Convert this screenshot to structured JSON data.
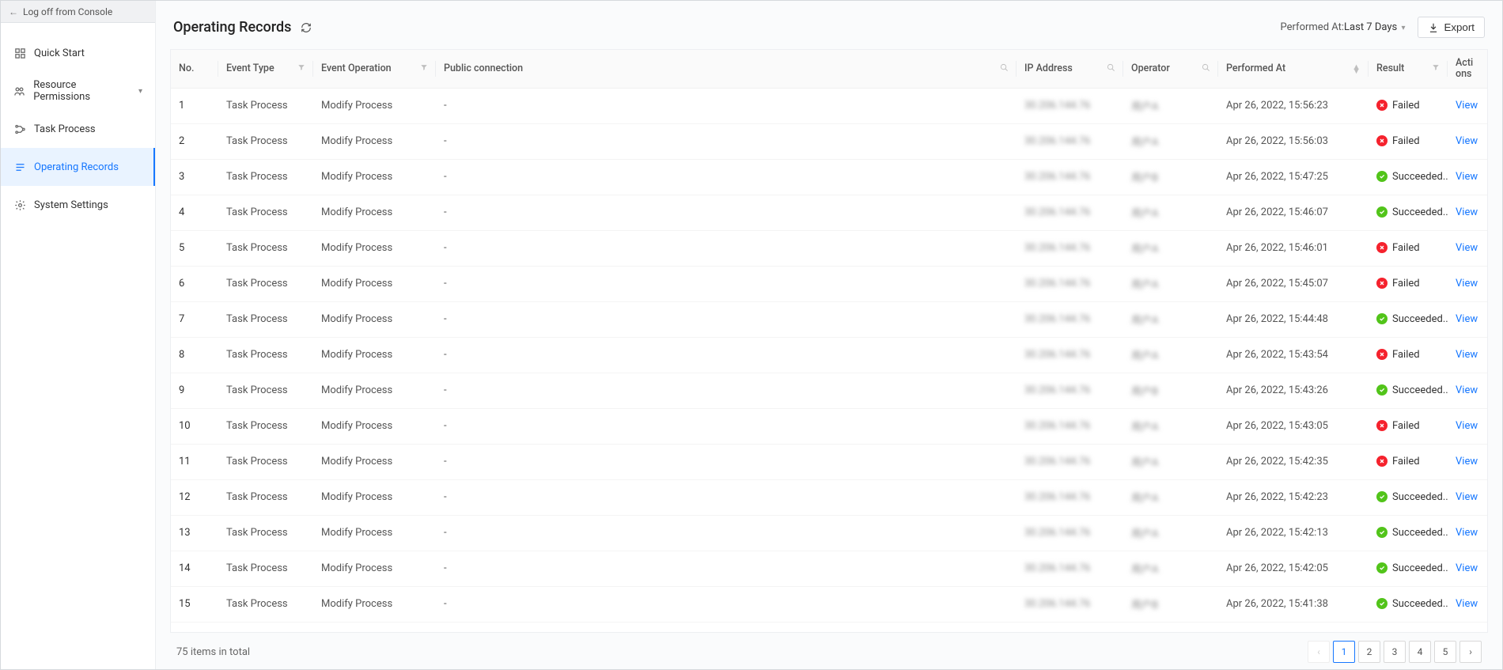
{
  "sidebar": {
    "logoff": "Log off from Console",
    "items": [
      {
        "label": "Quick Start",
        "active": false,
        "expandable": false
      },
      {
        "label": "Resource Permissions",
        "active": false,
        "expandable": true
      },
      {
        "label": "Task Process",
        "active": false,
        "expandable": false
      },
      {
        "label": "Operating Records",
        "active": true,
        "expandable": false
      },
      {
        "label": "System Settings",
        "active": false,
        "expandable": false
      }
    ]
  },
  "header": {
    "title": "Operating Records",
    "range_label": "Performed At:",
    "range_value": "Last 7 Days",
    "export": "Export"
  },
  "columns": {
    "no": "No.",
    "event_type": "Event Type",
    "event_operation": "Event Operation",
    "public_connection": "Public connection",
    "ip_address": "IP Address",
    "operator": "Operator",
    "performed_at": "Performed At",
    "result": "Result",
    "actions_l1": "Acti",
    "actions_l2": "ons"
  },
  "rows": [
    {
      "no": "1",
      "event_type": "Task Process",
      "event_operation": "Modify Process",
      "public_connection": "-",
      "ip": "30.206.144.76",
      "operator": "用户A",
      "performed_at": "Apr 26, 2022, 15:56:23",
      "result": "Failed",
      "action": "View"
    },
    {
      "no": "2",
      "event_type": "Task Process",
      "event_operation": "Modify Process",
      "public_connection": "-",
      "ip": "30.206.144.76",
      "operator": "用户A",
      "performed_at": "Apr 26, 2022, 15:56:03",
      "result": "Failed",
      "action": "View"
    },
    {
      "no": "3",
      "event_type": "Task Process",
      "event_operation": "Modify Process",
      "public_connection": "-",
      "ip": "30.206.144.76",
      "operator": "用户B",
      "performed_at": "Apr 26, 2022, 15:47:25",
      "result": "Succeeded...",
      "action": "View"
    },
    {
      "no": "4",
      "event_type": "Task Process",
      "event_operation": "Modify Process",
      "public_connection": "-",
      "ip": "30.206.144.76",
      "operator": "用户A",
      "performed_at": "Apr 26, 2022, 15:46:07",
      "result": "Succeeded...",
      "action": "View"
    },
    {
      "no": "5",
      "event_type": "Task Process",
      "event_operation": "Modify Process",
      "public_connection": "-",
      "ip": "30.206.144.76",
      "operator": "用户A",
      "performed_at": "Apr 26, 2022, 15:46:01",
      "result": "Failed",
      "action": "View"
    },
    {
      "no": "6",
      "event_type": "Task Process",
      "event_operation": "Modify Process",
      "public_connection": "-",
      "ip": "30.206.144.76",
      "operator": "用户A",
      "performed_at": "Apr 26, 2022, 15:45:07",
      "result": "Failed",
      "action": "View"
    },
    {
      "no": "7",
      "event_type": "Task Process",
      "event_operation": "Modify Process",
      "public_connection": "-",
      "ip": "30.206.144.76",
      "operator": "用户A",
      "performed_at": "Apr 26, 2022, 15:44:48",
      "result": "Succeeded...",
      "action": "View"
    },
    {
      "no": "8",
      "event_type": "Task Process",
      "event_operation": "Modify Process",
      "public_connection": "-",
      "ip": "30.206.144.76",
      "operator": "用户A",
      "performed_at": "Apr 26, 2022, 15:43:54",
      "result": "Failed",
      "action": "View"
    },
    {
      "no": "9",
      "event_type": "Task Process",
      "event_operation": "Modify Process",
      "public_connection": "-",
      "ip": "30.206.144.76",
      "operator": "用户B",
      "performed_at": "Apr 26, 2022, 15:43:26",
      "result": "Succeeded...",
      "action": "View"
    },
    {
      "no": "10",
      "event_type": "Task Process",
      "event_operation": "Modify Process",
      "public_connection": "-",
      "ip": "30.206.144.76",
      "operator": "用户A",
      "performed_at": "Apr 26, 2022, 15:43:05",
      "result": "Failed",
      "action": "View"
    },
    {
      "no": "11",
      "event_type": "Task Process",
      "event_operation": "Modify Process",
      "public_connection": "-",
      "ip": "30.206.144.76",
      "operator": "用户A",
      "performed_at": "Apr 26, 2022, 15:42:35",
      "result": "Failed",
      "action": "View"
    },
    {
      "no": "12",
      "event_type": "Task Process",
      "event_operation": "Modify Process",
      "public_connection": "-",
      "ip": "30.206.144.76",
      "operator": "用户A",
      "performed_at": "Apr 26, 2022, 15:42:23",
      "result": "Succeeded...",
      "action": "View"
    },
    {
      "no": "13",
      "event_type": "Task Process",
      "event_operation": "Modify Process",
      "public_connection": "-",
      "ip": "30.206.144.76",
      "operator": "用户A",
      "performed_at": "Apr 26, 2022, 15:42:13",
      "result": "Succeeded...",
      "action": "View"
    },
    {
      "no": "14",
      "event_type": "Task Process",
      "event_operation": "Modify Process",
      "public_connection": "-",
      "ip": "30.206.144.76",
      "operator": "用户A",
      "performed_at": "Apr 26, 2022, 15:42:05",
      "result": "Succeeded...",
      "action": "View"
    },
    {
      "no": "15",
      "event_type": "Task Process",
      "event_operation": "Modify Process",
      "public_connection": "-",
      "ip": "30.206.144.76",
      "operator": "用户B",
      "performed_at": "Apr 26, 2022, 15:41:38",
      "result": "Succeeded...",
      "action": "View"
    }
  ],
  "footer": {
    "total_text": "75 items in total"
  },
  "pagination": {
    "pages": [
      "1",
      "2",
      "3",
      "4",
      "5"
    ],
    "current": "1"
  }
}
